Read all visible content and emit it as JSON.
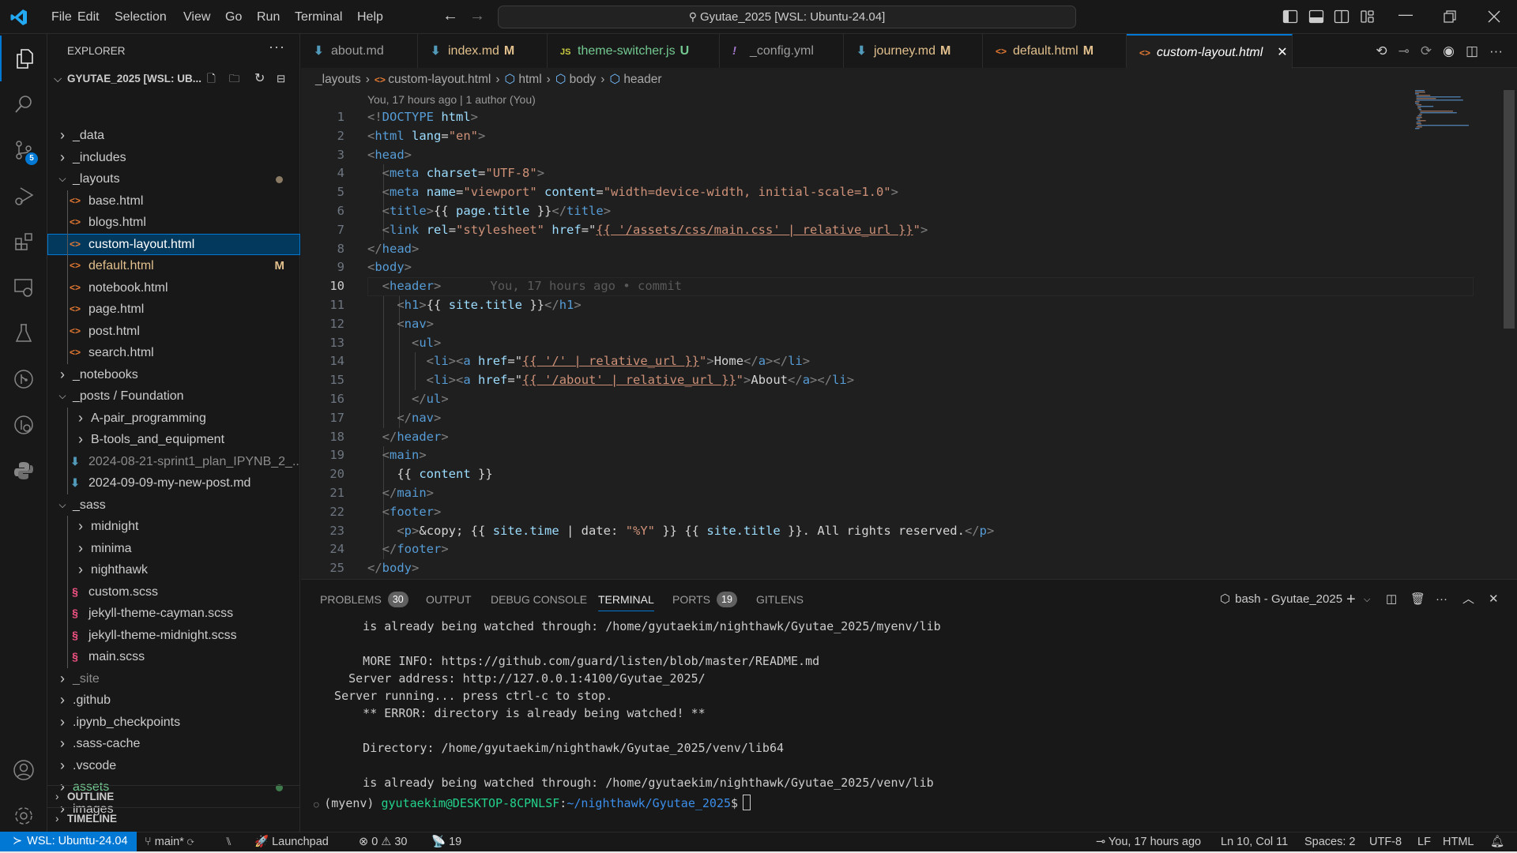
{
  "titlebar": {
    "menu": [
      "File",
      "Edit",
      "Selection",
      "View",
      "Go",
      "Run",
      "Terminal",
      "Help"
    ],
    "command_center": "Gyutae_2025 [WSL: Ubuntu-24.04]",
    "window_controls": [
      "toggle-primary-sidebar",
      "toggle-panel",
      "toggle-secondary-sidebar",
      "customize-layout",
      "minimize",
      "restore",
      "close"
    ]
  },
  "activity_bar": {
    "items": [
      {
        "name": "explorer",
        "active": true
      },
      {
        "name": "search"
      },
      {
        "name": "source-control",
        "badge": "5"
      },
      {
        "name": "run-and-debug"
      },
      {
        "name": "extensions"
      },
      {
        "name": "remote-explorer"
      },
      {
        "name": "testing"
      },
      {
        "name": "gitlens"
      },
      {
        "name": "gitlens-inspect"
      },
      {
        "name": "python"
      }
    ],
    "bottom": [
      "accounts",
      "manage"
    ]
  },
  "sidebar": {
    "title": "EXPLORER",
    "more": "···",
    "root": "GYUTAE_2025 [WSL: UB...",
    "tree": [
      {
        "label": "_data",
        "type": "folder",
        "open": false,
        "depth": 0
      },
      {
        "label": "_includes",
        "type": "folder",
        "open": false,
        "depth": 0
      },
      {
        "label": "_layouts",
        "type": "folder",
        "open": true,
        "depth": 0,
        "dot": "#8b7a63"
      },
      {
        "label": "base.html",
        "type": "html",
        "depth": 1
      },
      {
        "label": "blogs.html",
        "type": "html",
        "depth": 1
      },
      {
        "label": "custom-layout.html",
        "type": "html",
        "depth": 1,
        "selected": true
      },
      {
        "label": "default.html",
        "type": "html",
        "depth": 1,
        "status": "M",
        "color": "#e2c08d"
      },
      {
        "label": "notebook.html",
        "type": "html",
        "depth": 1
      },
      {
        "label": "page.html",
        "type": "html",
        "depth": 1
      },
      {
        "label": "post.html",
        "type": "html",
        "depth": 1
      },
      {
        "label": "search.html",
        "type": "html",
        "depth": 1
      },
      {
        "label": "_notebooks",
        "type": "folder",
        "open": false,
        "depth": 0
      },
      {
        "label": "_posts / Foundation",
        "type": "folder",
        "open": true,
        "depth": 0
      },
      {
        "label": "A-pair_programming",
        "type": "folder",
        "open": false,
        "depth": 1
      },
      {
        "label": "B-tools_and_equipment",
        "type": "folder",
        "open": false,
        "depth": 1
      },
      {
        "label": "2024-08-21-sprint1_plan_IPYNB_2_....",
        "type": "md",
        "depth": 1,
        "color": "#8c8c8c"
      },
      {
        "label": "2024-09-09-my-new-post.md",
        "type": "md",
        "depth": 1
      },
      {
        "label": "_sass",
        "type": "folder",
        "open": true,
        "depth": 0
      },
      {
        "label": "midnight",
        "type": "folder",
        "open": false,
        "depth": 1
      },
      {
        "label": "minima",
        "type": "folder",
        "open": false,
        "depth": 1
      },
      {
        "label": "nighthawk",
        "type": "folder",
        "open": false,
        "depth": 1
      },
      {
        "label": "custom.scss",
        "type": "scss",
        "depth": 1
      },
      {
        "label": "jekyll-theme-cayman.scss",
        "type": "scss",
        "depth": 1
      },
      {
        "label": "jekyll-theme-midnight.scss",
        "type": "scss",
        "depth": 1
      },
      {
        "label": "main.scss",
        "type": "scss",
        "depth": 1
      },
      {
        "label": "_site",
        "type": "folder",
        "open": false,
        "depth": 0,
        "color": "#8c8c8c"
      },
      {
        "label": ".github",
        "type": "folder",
        "open": false,
        "depth": 0
      },
      {
        "label": ".ipynb_checkpoints",
        "type": "folder",
        "open": false,
        "depth": 0
      },
      {
        "label": ".sass-cache",
        "type": "folder",
        "open": false,
        "depth": 0
      },
      {
        "label": ".vscode",
        "type": "folder",
        "open": false,
        "depth": 0
      },
      {
        "label": "assets",
        "type": "folder",
        "open": false,
        "depth": 0,
        "color": "#73c991",
        "dot": "#3f7a4c"
      },
      {
        "label": "images",
        "type": "folder",
        "open": false,
        "depth": 0
      }
    ],
    "sections": [
      "OUTLINE",
      "TIMELINE"
    ]
  },
  "tabs": [
    {
      "label": "about.md",
      "icon": "md"
    },
    {
      "label": "index.md",
      "icon": "md",
      "status": "M",
      "color": "#e2c08d"
    },
    {
      "label": "theme-switcher.js",
      "icon": "js",
      "status": "U",
      "color": "#73c991"
    },
    {
      "label": "_config.yml",
      "icon": "yml"
    },
    {
      "label": "journey.md",
      "icon": "md",
      "status": "M",
      "color": "#e2c08d"
    },
    {
      "label": "default.html",
      "icon": "html",
      "status": "M",
      "color": "#e2c08d"
    },
    {
      "label": "custom-layout.html",
      "icon": "html",
      "active": true
    }
  ],
  "breadcrumb": [
    "_layouts",
    "custom-layout.html",
    "html",
    "body",
    "header"
  ],
  "blame_header": "You, 17 hours ago | 1 author (You)",
  "inline_blame": "You, 17 hours ago • commit",
  "current_line": 10,
  "code_lines": [
    "<!DOCTYPE html>",
    "<html lang=\"en\">",
    "<head>",
    "  <meta charset=\"UTF-8\">",
    "  <meta name=\"viewport\" content=\"width=device-width, initial-scale=1.0\">",
    "  <title>{{ page.title }}</title>",
    "  <link rel=\"stylesheet\" href=\"{{ '/assets/css/main.css' | relative_url }}\">",
    "</head>",
    "<body>",
    "  <header>",
    "    <h1>{{ site.title }}</h1>",
    "    <nav>",
    "      <ul>",
    "        <li><a href=\"{{ '/' | relative_url }}\">Home</a></li>",
    "        <li><a href=\"{{ '/about' | relative_url }}\">About</a></li>",
    "      </ul>",
    "    </nav>",
    "  </header>",
    "  <main>",
    "    {{ content }}",
    "  </main>",
    "  <footer>",
    "    <p>&copy; {{ site.time | date: \"%Y\" }} {{ site.title }}. All rights reserved.</p>",
    "  </footer>",
    "</body>"
  ],
  "panel": {
    "tabs": [
      {
        "label": "PROBLEMS",
        "badge": "30"
      },
      {
        "label": "OUTPUT"
      },
      {
        "label": "DEBUG CONSOLE"
      },
      {
        "label": "TERMINAL",
        "active": true
      },
      {
        "label": "PORTS",
        "badge": "19"
      },
      {
        "label": "GITLENS"
      }
    ],
    "terminal_name": "bash - Gyutae_2025",
    "terminal_lines": [
      "      is already being watched through: /home/gyutaekim/nighthawk/Gyutae_2025/myenv/lib",
      "",
      "      MORE INFO: https://github.com/guard/listen/blob/master/README.md",
      "    Server address: http://127.0.0.1:4100/Gyutae_2025/",
      "  Server running... press ctrl-c to stop.",
      "      ** ERROR: directory is already being watched! **",
      "",
      "      Directory: /home/gyutaekim/nighthawk/Gyutae_2025/venv/lib64",
      "",
      "      is already being watched through: /home/gyutaekim/nighthawk/Gyutae_2025/venv/lib"
    ],
    "prompt": {
      "env": "(myenv) ",
      "user": "gyutaekim@DESKTOP-8CPNLSF",
      "sep": ":",
      "path": "~/nighthawk/Gyutae_2025",
      "sym": "$"
    }
  },
  "statusbar": {
    "remote": "WSL: Ubuntu-24.04",
    "branch": "main*",
    "launchpad": "Launchpad",
    "errors": "0",
    "warnings": "30",
    "ports": "19",
    "blame": "You, 17 hours ago",
    "position": "Ln 10, Col 11",
    "indent": "Spaces: 2",
    "encoding": "UTF-8",
    "eol": "LF",
    "language": "HTML"
  },
  "colors": {
    "accent": "#0078d4",
    "modified": "#e2c08d",
    "untracked": "#73c991",
    "html_icon": "#e37933",
    "md_icon": "#519aba",
    "scss_icon": "#f55385"
  }
}
